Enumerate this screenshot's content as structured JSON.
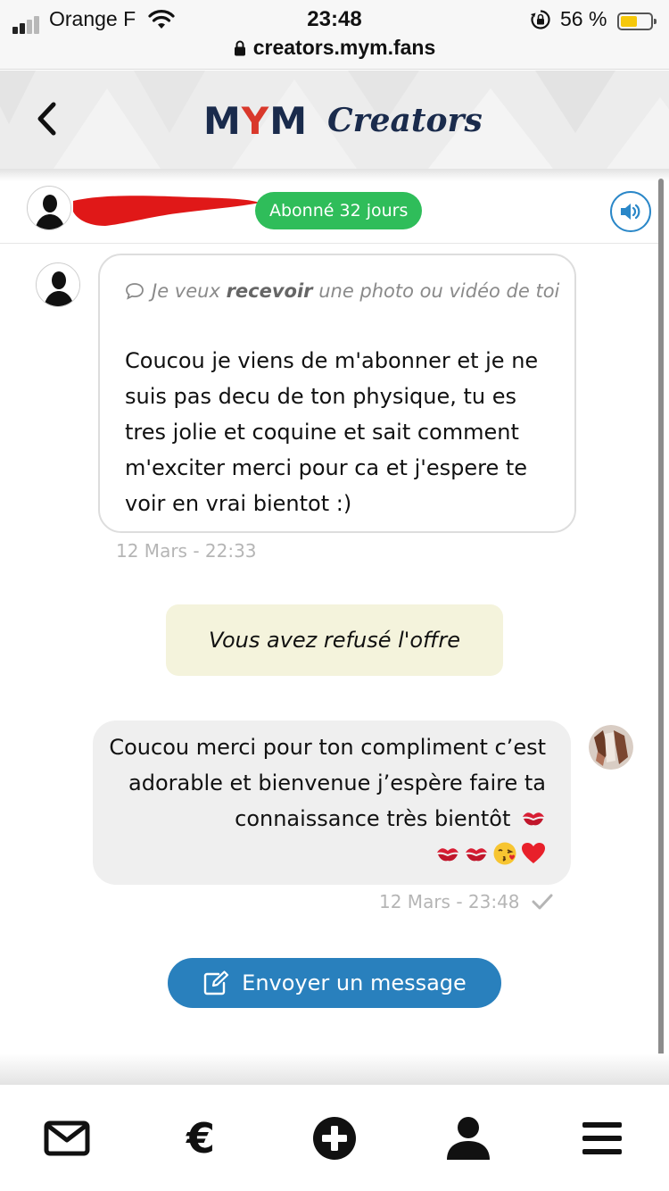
{
  "status_bar": {
    "carrier": "Orange F",
    "time": "23:48",
    "battery_percent": "56 %",
    "battery_level": 0.56,
    "signal_bars": 2,
    "url": "creators.mym.fans"
  },
  "app_header": {
    "logo_brand": "MYM",
    "logo_sub": "Creators",
    "back_icon": "chevron-left-icon"
  },
  "conversation": {
    "subscription_badge": "Abonné 32 jours",
    "sound_icon": "speaker-icon",
    "accent_color": "#2a87c8",
    "badge_color": "#2fbd5a"
  },
  "messages": {
    "incoming": {
      "request_prefix": "Je veux ",
      "request_bold": "recevoir",
      "request_suffix": " une photo ou vidéo de toi",
      "text": "Coucou je viens de m'abonner et je ne suis pas decu de ton physique, tu es tres jolie et coquine et sait comment m'exciter merci pour ca et j'espere te voir en vrai bientot :)",
      "timestamp": "12 Mars - 22:33"
    },
    "system_notice": "Vous avez refusé l'offre",
    "outgoing": {
      "text": "Coucou merci pour ton compliment c’est adorable et bienvenue j’espère faire ta connaissance très bientôt",
      "emojis": [
        "kiss-mark",
        "kiss-mark",
        "kiss-mark",
        "face-blowing-kiss",
        "red-heart"
      ],
      "timestamp": "12 Mars - 23:48",
      "status_icon": "checkmark-icon"
    }
  },
  "actions": {
    "send_message": "Envoyer un message",
    "send_icon": "edit-icon",
    "button_color": "#2980bd"
  },
  "bottom_nav": {
    "items": [
      {
        "icon": "envelope-icon"
      },
      {
        "icon": "euro-icon",
        "glyph": "€"
      },
      {
        "icon": "plus-circle-icon"
      },
      {
        "icon": "user-icon"
      },
      {
        "icon": "menu-icon"
      }
    ]
  }
}
